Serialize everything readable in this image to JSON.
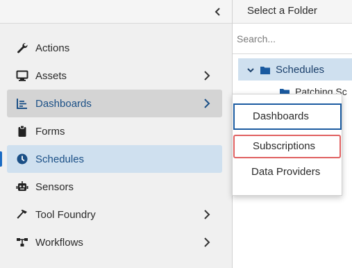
{
  "sidebar": {
    "items": [
      {
        "label": "Actions",
        "icon": "wrench-icon",
        "has_chevron": false,
        "state": "normal"
      },
      {
        "label": "Assets",
        "icon": "monitor-icon",
        "has_chevron": true,
        "state": "normal"
      },
      {
        "label": "Dashboards",
        "icon": "chart-icon",
        "has_chevron": true,
        "state": "hover"
      },
      {
        "label": "Forms",
        "icon": "clipboard-icon",
        "has_chevron": false,
        "state": "normal"
      },
      {
        "label": "Schedules",
        "icon": "clock-icon",
        "has_chevron": false,
        "state": "selected"
      },
      {
        "label": "Sensors",
        "icon": "robot-icon",
        "has_chevron": false,
        "state": "normal"
      },
      {
        "label": "Tool Foundry",
        "icon": "hammer-icon",
        "has_chevron": true,
        "state": "normal"
      },
      {
        "label": "Workflows",
        "icon": "sitemap-icon",
        "has_chevron": true,
        "state": "normal"
      }
    ]
  },
  "panel": {
    "title": "Select a Folder",
    "search_placeholder": "Search...",
    "tree_root": "Schedules",
    "tree_child": "Patching Sc"
  },
  "popup": {
    "items": [
      {
        "label": "Dashboards",
        "state": "focused"
      },
      {
        "label": "Subscriptions",
        "state": "outlined"
      },
      {
        "label": "Data Providers",
        "state": "normal"
      }
    ]
  },
  "colors": {
    "accent": "#1a5aa0",
    "selected_bg": "#cfe0ef",
    "hover_bg": "#d4d4d4",
    "highlight_outline": "#e06060"
  }
}
